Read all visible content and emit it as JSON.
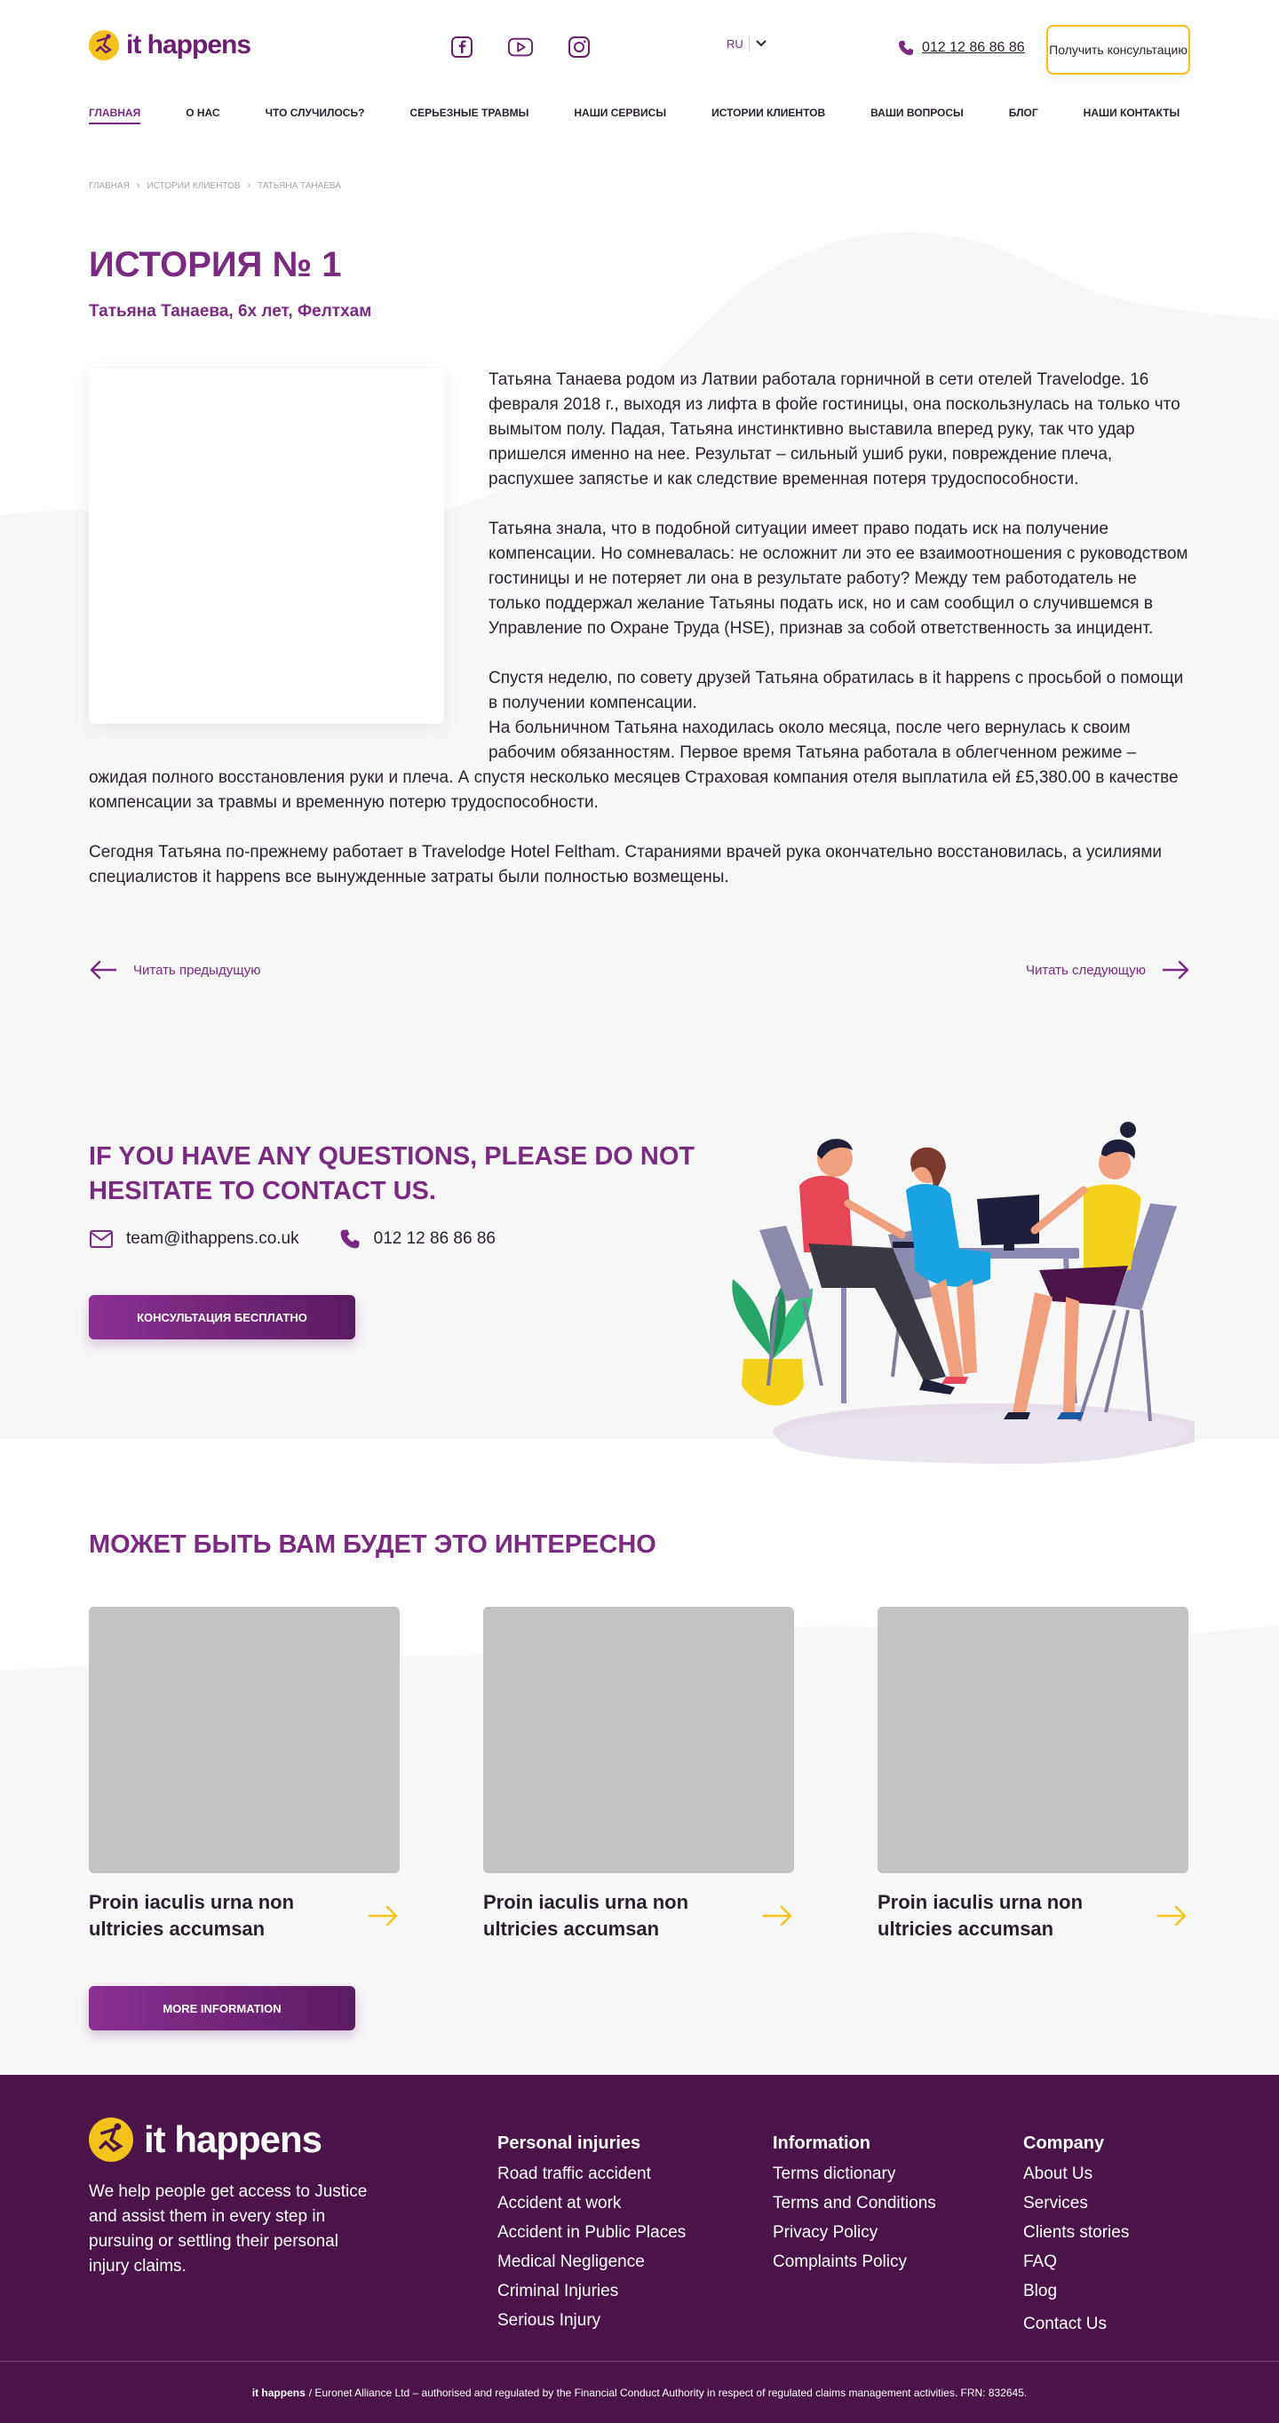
{
  "brand": {
    "logo_text": "it happens",
    "accent": "#7a2a81",
    "yellow": "#f4c21b",
    "footer_bg": "#4a1449"
  },
  "header": {
    "social_icons": [
      "facebook-icon",
      "youtube-icon",
      "instagram-icon"
    ],
    "lang": "RU",
    "phone": "012 12 86 86 86",
    "consult_button": "Получить консультацию"
  },
  "nav": [
    "ГЛАВНАЯ",
    "О НАС",
    "ЧТО СЛУЧИЛОСЬ?",
    "СЕРЬЕЗНЫЕ ТРАВМЫ",
    "НАШИ СЕРВИСЫ",
    "ИСТОРИИ КЛИЕНТОВ",
    "ВАШИ ВОПРОСЫ",
    "БЛОГ",
    "НАШИ КОНТАКТЫ"
  ],
  "breadcrumb": [
    "ГЛАВНАЯ",
    "ИСТОРИИ КЛИЕНТОВ",
    "ТАТЬЯНА ТАНАЕВА"
  ],
  "story": {
    "title": "ИСТОРИЯ № 1",
    "subtitle": "Татьяна Танаева, 6х лет, Фелтхам",
    "paragraphs": [
      "Татьяна Танаева родом из Латвии работала горничной в сети отелей Travelodge. 16 февраля 2018 г., выходя из лифта в фойе гостиницы, она поскользнулась на только что вымытом полу. Падая, Татьяна инстинктивно выставила вперед руку, так что удар пришелся именно на нее. Результат – сильный ушиб руки, повреждение плеча, распухшее запястье и как следствие временная потеря трудоспособности.",
      "Татьяна знала, что в подобной ситуации имеет право подать иск на получение компенсации. Но сомневалась: не осложнит ли это ее взаимоотношения с руководством гостиницы и не потеряет ли она в результате работу? Между тем работодатель не только поддержал желание Татьяны подать иск, но и сам сообщил о случившемся в Управление по Охране Труда (HSE), признав за собой ответственность за инцидент.",
      "Спустя неделю, по совету друзей Татьяна обратилась в it happens с просьбой о помощи в получении компенсации.",
      "На больничном Татьяна находилась около месяца, после чего вернулась к своим рабочим обязанностям. Первое время Татьяна работала в облегченном режиме – ожидая полного восстановления руки и плеча. А спустя несколько месяцев Страховая компания отеля выплатила ей £5,380.00 в качестве компенсации за травмы и временную потерю трудоспособности.",
      "Сегодня Татьяна по-прежнему работает в Travelodge Hotel Feltham. Стараниями врачей рука окончательно восстановилась, а усилиями специалистов it happens все вынужденные затраты были полностью возмещены."
    ],
    "prev": "Читать предыдущую",
    "next": "Читать следующую"
  },
  "contact": {
    "title": "IF YOU HAVE ANY QUESTIONS, PLEASE DO NOT HESITATE TO CONTACT US.",
    "email": "team@ithappens.co.uk",
    "phone": "012 12 86 86 86",
    "button": "КОНСУЛЬТАЦИЯ БЕСПЛАТНО"
  },
  "interesting": {
    "title": "МОЖЕТ БЫТЬ ВАМ БУДЕТ ЭТО ИНТЕРЕСНО",
    "cards": [
      {
        "title": "Proin iaculis urna non ultricies accumsan"
      },
      {
        "title": "Proin iaculis urna non ultricies accumsan"
      },
      {
        "title": "Proin iaculis urna non ultricies accumsan"
      }
    ],
    "button": "MORE INFORMATION"
  },
  "footer": {
    "logo_text": "it happens",
    "description": "We help people get access to Justice and assist them in every step in pursuing or settling their personal injury claims.",
    "columns": [
      {
        "title": "Personal injuries",
        "links": [
          "Road traffic accident",
          "Accident at work",
          "Accident in Public Places",
          "Medical Negligence",
          "Criminal Injuries",
          "Serious Injury"
        ]
      },
      {
        "title": "Information",
        "links": [
          "Terms dictionary",
          "Terms and Conditions",
          "Privacy Policy",
          "Complaints Policy"
        ]
      },
      {
        "title": "Company",
        "links": [
          "About Us",
          "Services",
          "Clients stories",
          "FAQ",
          "Blog",
          "Contact Us"
        ]
      }
    ],
    "legal_brand": "it happens",
    "legal_text": "/ Euronet Alliance Ltd – authorised and regulated by the Financial Conduct Authority in respect of regulated claims management activities. FRN: 832645."
  }
}
